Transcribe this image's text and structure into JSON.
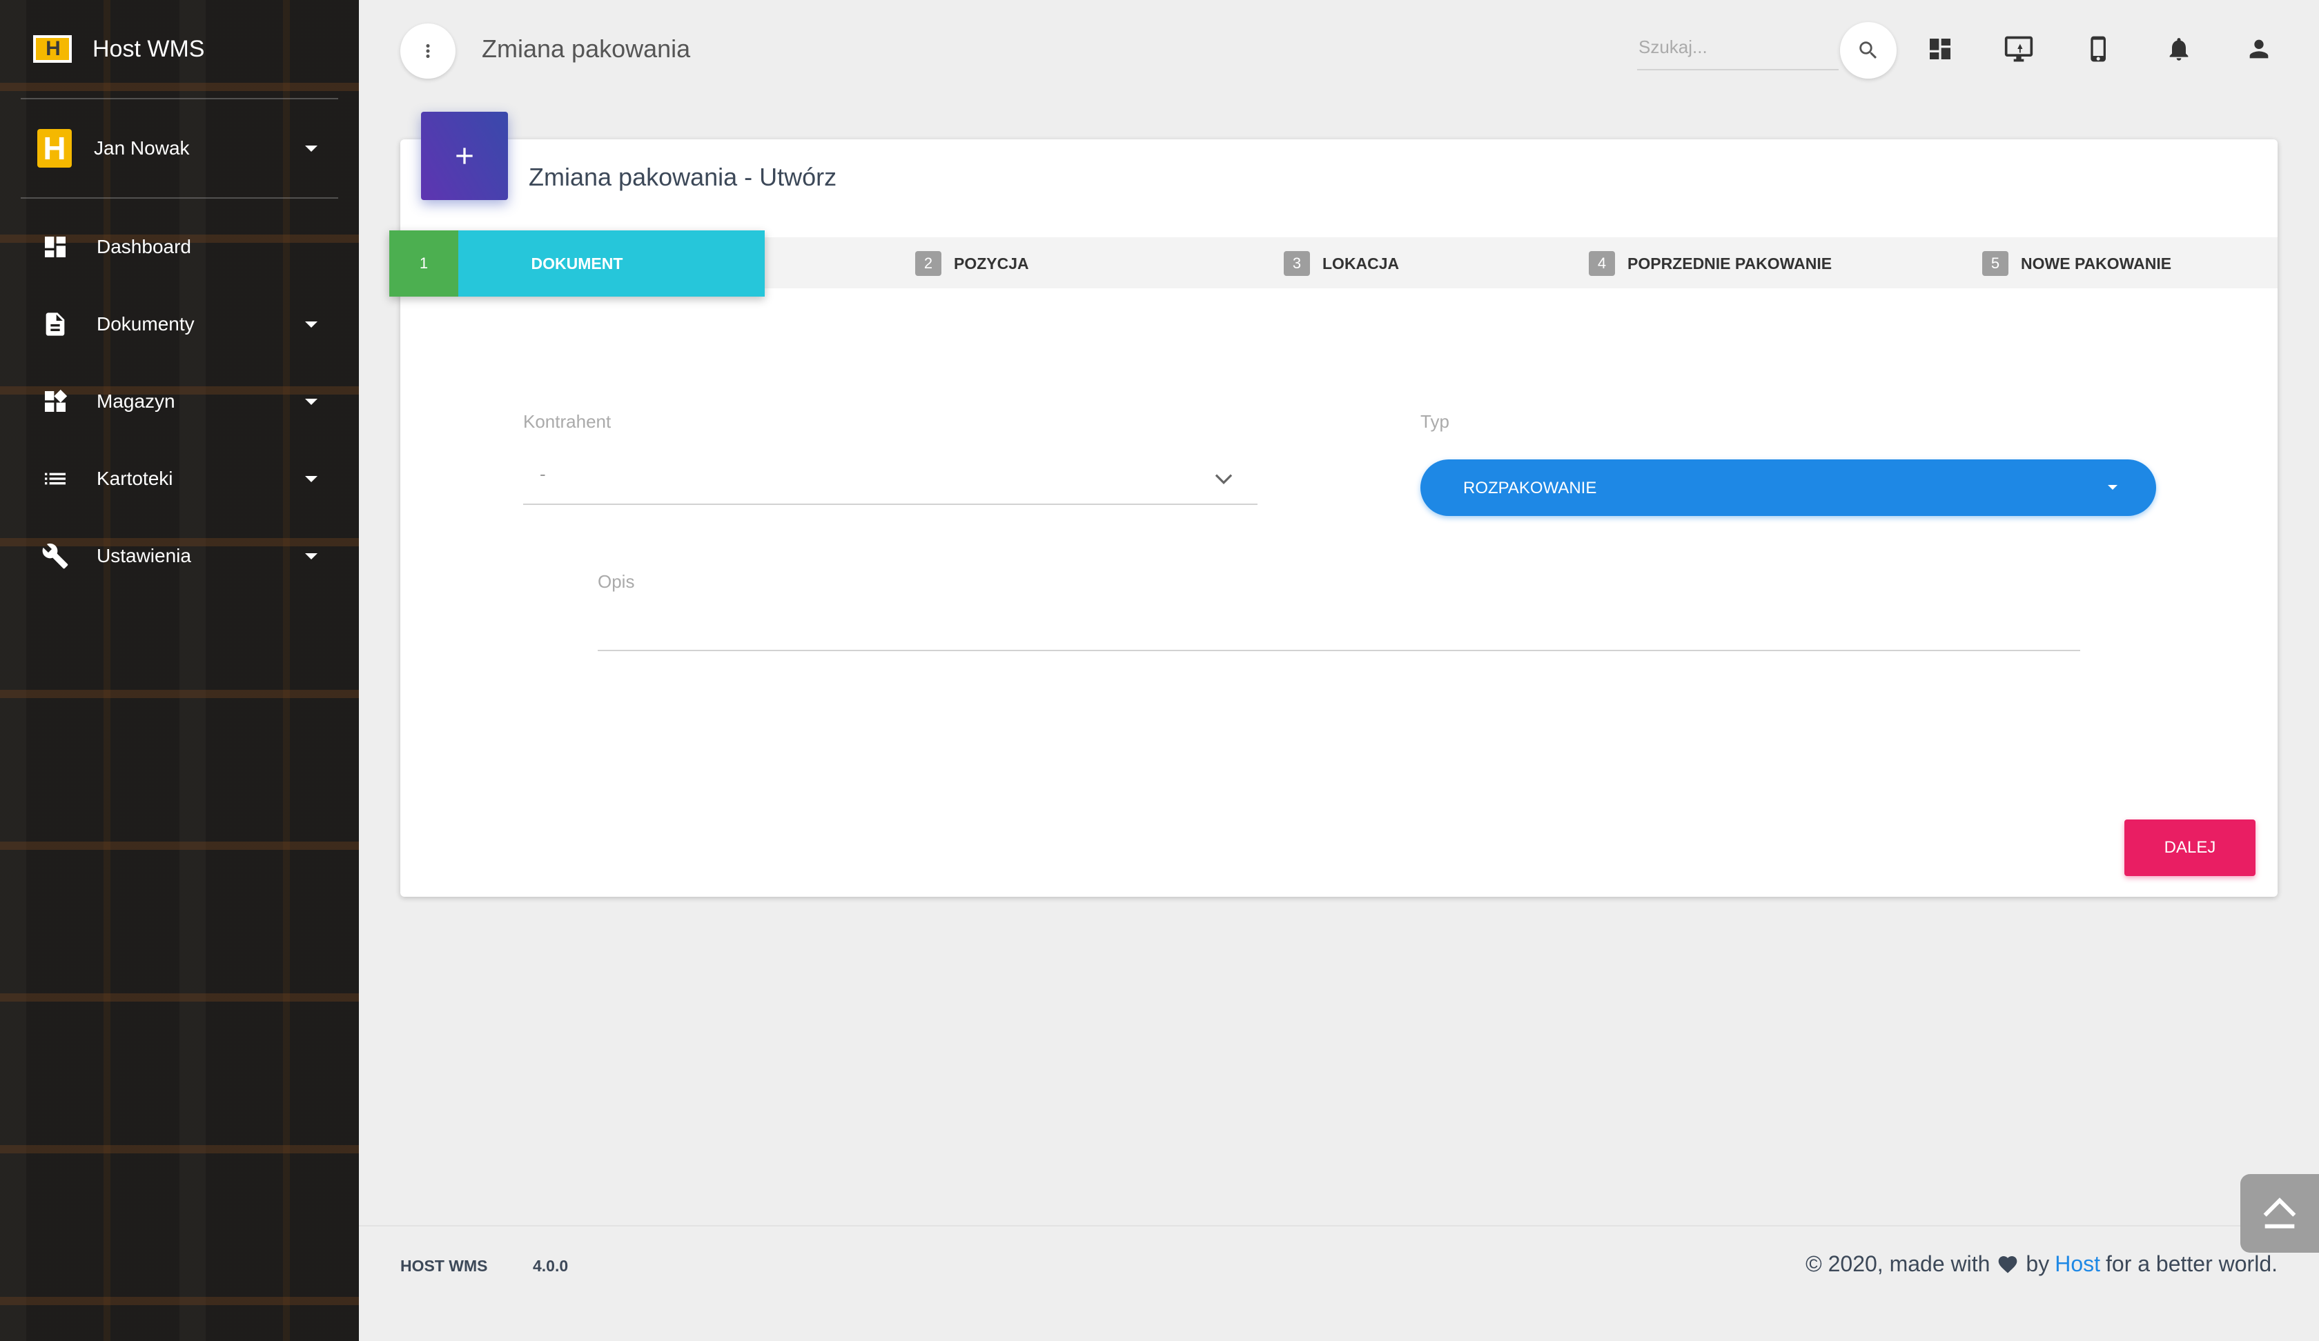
{
  "app": {
    "name": "Host WMS",
    "logo_text": "H",
    "user_initial": "H"
  },
  "user": {
    "name": "Jan Nowak"
  },
  "sidebar": {
    "items": [
      {
        "label": "Dashboard",
        "icon": "dashboard-icon"
      },
      {
        "label": "Dokumenty",
        "icon": "document-icon"
      },
      {
        "label": "Magazyn",
        "icon": "widgets-icon"
      },
      {
        "label": "Kartoteki",
        "icon": "list-icon"
      },
      {
        "label": "Ustawienia",
        "icon": "wrench-icon"
      }
    ]
  },
  "header": {
    "title": "Zmiana pakowania",
    "search_placeholder": "Szukaj..."
  },
  "card": {
    "title": "Zmiana pakowania - Utwórz",
    "steps": [
      {
        "num": "1",
        "label": "DOKUMENT"
      },
      {
        "num": "2",
        "label": "POZYCJA"
      },
      {
        "num": "3",
        "label": "LOKACJA"
      },
      {
        "num": "4",
        "label": "POPRZEDNIE PAKOWANIE"
      },
      {
        "num": "5",
        "label": "NOWE PAKOWANIE"
      }
    ],
    "form": {
      "kontrahent_label": "Kontrahent",
      "kontrahent_value": "-",
      "typ_label": "Typ",
      "typ_value": "ROZPAKOWANIE",
      "opis_label": "Opis",
      "opis_value": ""
    },
    "next_label": "DALEJ"
  },
  "footer": {
    "app": "HOST WMS",
    "version": "4.0.0",
    "copyright_prefix": "© 2020, made with",
    "by": "by",
    "host_link": "Host",
    "suffix": "for a better world."
  },
  "colors": {
    "primary": "#1e88e5",
    "accent": "#e91e63",
    "step_active": "#26c6da",
    "step_number": "#4caf50",
    "card_icon": "#3949ab"
  }
}
